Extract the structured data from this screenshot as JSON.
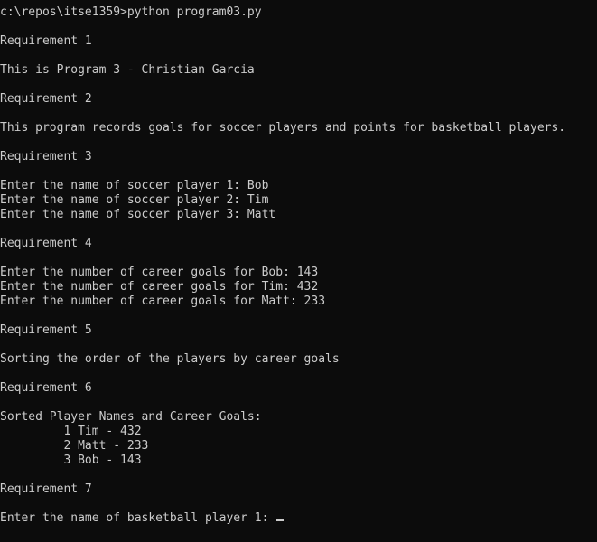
{
  "console": {
    "lines": [
      "c:\\repos\\itse1359>python program03.py",
      "",
      "Requirement 1",
      "",
      "This is Program 3 - Christian Garcia",
      "",
      "Requirement 2",
      "",
      "This program records goals for soccer players and points for basketball players.",
      "",
      "Requirement 3",
      "",
      "Enter the name of soccer player 1: Bob",
      "Enter the name of soccer player 2: Tim",
      "Enter the name of soccer player 3: Matt",
      "",
      "Requirement 4",
      "",
      "Enter the number of career goals for Bob: 143",
      "Enter the number of career goals for Tim: 432",
      "Enter the number of career goals for Matt: 233",
      "",
      "Requirement 5",
      "",
      "Sorting the order of the players by career goals",
      "",
      "Requirement 6",
      "",
      "Sorted Player Names and Career Goals:",
      "         1 Tim - 432",
      "         2 Matt - 233",
      "         3 Bob - 143",
      "",
      "Requirement 7",
      "",
      "Enter the name of basketball player 1: "
    ]
  }
}
